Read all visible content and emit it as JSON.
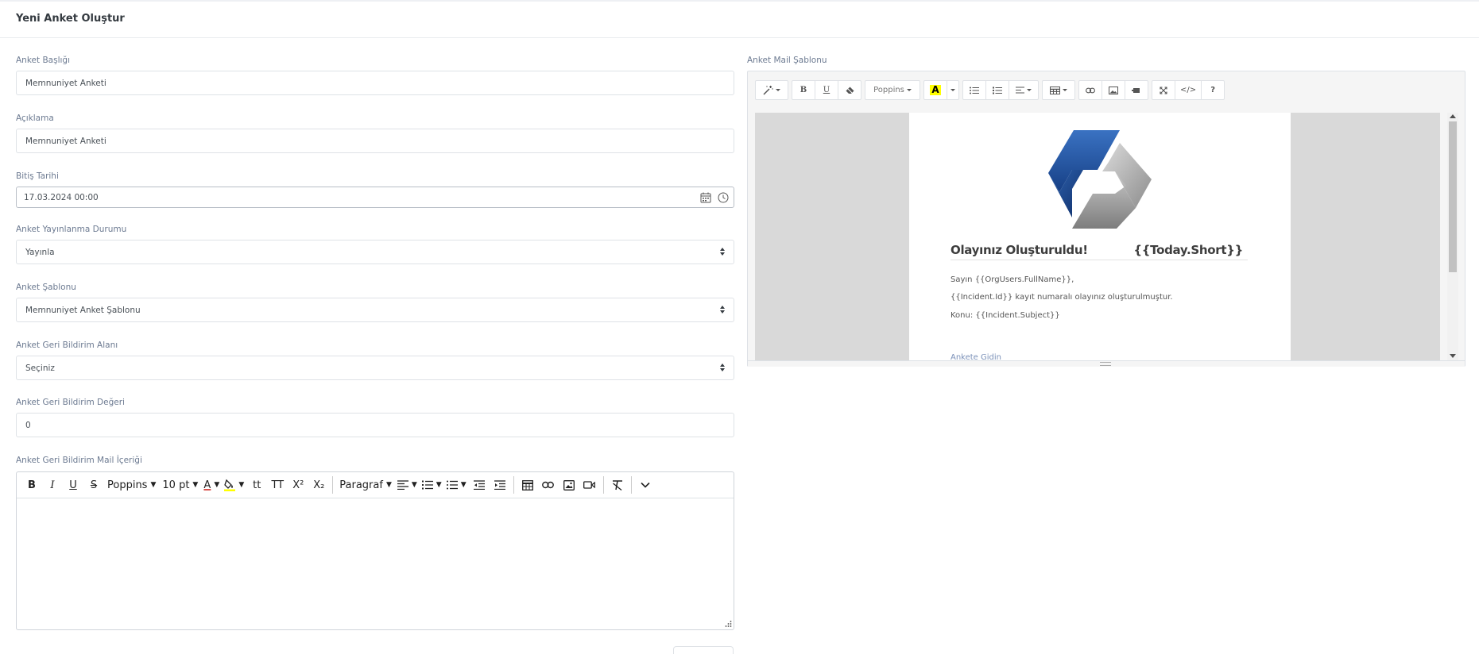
{
  "header": {
    "title": "Yeni Anket Oluştur"
  },
  "form": {
    "survey_title": {
      "label": "Anket Başlığı",
      "value": "Memnuniyet Anketi"
    },
    "description": {
      "label": "Açıklama",
      "value": "Memnuniyet Anketi"
    },
    "end_date": {
      "label": "Bitiş Tarihi",
      "value": "17.03.2024 00:00"
    },
    "publish_status": {
      "label": "Anket Yayınlanma Durumu",
      "value": "Yayınla"
    },
    "template": {
      "label": "Anket Şablonu",
      "value": "Memnuniyet Anket Şablonu"
    },
    "feedback_field": {
      "label": "Anket Geri Bildirim Alanı",
      "value": "Seçiniz"
    },
    "feedback_value": {
      "label": "Anket Geri Bildirim Değeri",
      "value": "0"
    },
    "feedback_mail": {
      "label": "Anket Geri Bildirim Mail İçeriği"
    }
  },
  "rich_toolbar": {
    "bold": "B",
    "italic": "I",
    "underline": "U",
    "strike": "S",
    "font": "Poppins",
    "size": "10 pt",
    "font_color": "A",
    "font_transform": "tt",
    "font_size_case": "TT",
    "superscript": "X²",
    "subscript": "X₂",
    "paragraph": "Paragraf"
  },
  "mail_template": {
    "label": "Anket Mail Şablonu",
    "toolbar": {
      "bold": "B",
      "underline": "U",
      "font": "Poppins",
      "color": "A",
      "code": "</>",
      "help": "?"
    },
    "content": {
      "heading_left": "Olayınız Oluşturuldu!",
      "heading_right": "{{Today.Short}}",
      "line1": "Sayın {{OrgUsers.FullName}},",
      "line2": "{{Incident.Id}} kayıt numaralı olayınız oluşturulmuştur.",
      "line3": "Konu: {{Incident.Subject}}",
      "link": "Ankete Gidin"
    }
  },
  "colors": {
    "label": "#6c7a91",
    "border": "#dee2e6",
    "logo_blue": "#2b5ca8",
    "logo_gray": "#a5a5a5",
    "highlight_yellow": "#ffff00"
  }
}
